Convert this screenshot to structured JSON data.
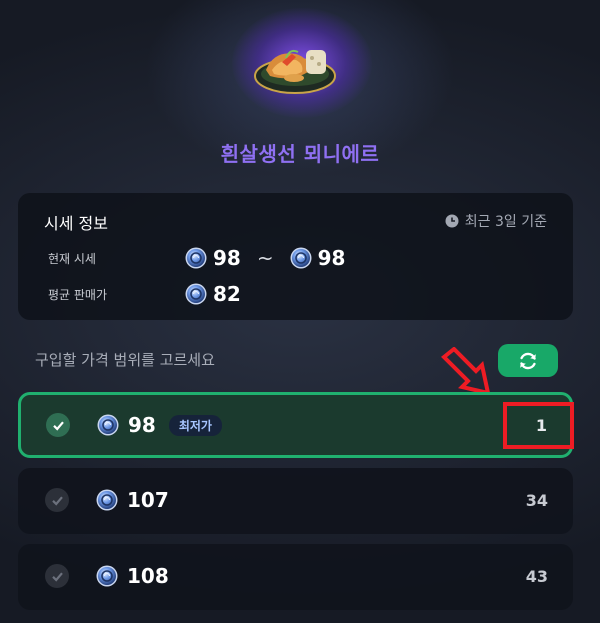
{
  "item": {
    "name": "흰살생선 뫼니에르",
    "icon": "fish-meuniere-dish-icon"
  },
  "price_info": {
    "title": "시세 정보",
    "period": "최근 3일 기준",
    "current_label": "현재 시세",
    "current_min": "98",
    "current_sep": "~",
    "current_max": "98",
    "average_label": "평균 판매가",
    "average_value": "82"
  },
  "selection": {
    "prompt": "구입할 가격 범위를 고르세요",
    "refresh_icon": "refresh-icon",
    "rows": [
      {
        "price": "98",
        "badge": "최저가",
        "count": "1",
        "selected": true
      },
      {
        "price": "107",
        "badge": "",
        "count": "34",
        "selected": false
      },
      {
        "price": "108",
        "badge": "",
        "count": "43",
        "selected": false
      }
    ]
  },
  "colors": {
    "title_purple": "#8f70f2",
    "accent_green": "#18a868",
    "annotation_red": "#ee1c24",
    "panel_bg": "#0e1119"
  }
}
